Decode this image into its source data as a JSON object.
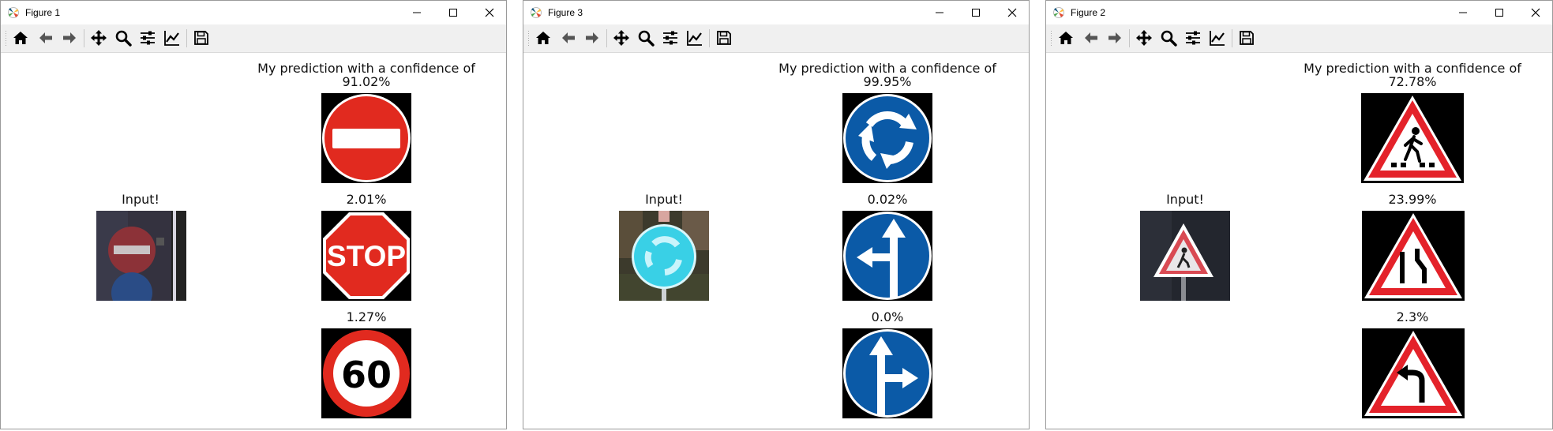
{
  "colors": {
    "prohibitory_red": "#e12a1f",
    "mandatory_blue": "#0b5aa7",
    "warning_red": "#e4222a",
    "toolbar_bg": "#f0f0f0"
  },
  "toolbar_tools": [
    "home-icon",
    "back-arrow-icon",
    "forward-arrow-icon",
    "pan-icon",
    "zoom-icon",
    "subplots-icon",
    "edit-axes-icon",
    "save-icon"
  ],
  "windows": [
    {
      "title": "Figure 1",
      "input_label": "Input!",
      "header_line1": "My prediction with a confidence of",
      "predictions": [
        {
          "confidence": "91.02%",
          "sign": "no-entry-sign"
        },
        {
          "confidence": "2.01%",
          "sign": "stop-sign",
          "sign_text": "STOP"
        },
        {
          "confidence": "1.27%",
          "sign": "speed-limit-60-sign",
          "sign_text": "60"
        }
      ]
    },
    {
      "title": "Figure 3",
      "input_label": "Input!",
      "header_line1": "My prediction with a confidence of",
      "predictions": [
        {
          "confidence": "99.95%",
          "sign": "roundabout-sign"
        },
        {
          "confidence": "0.02%",
          "sign": "straight-or-left-sign"
        },
        {
          "confidence": "0.0%",
          "sign": "straight-or-right-sign"
        }
      ]
    },
    {
      "title": "Figure 2",
      "input_label": "Input!",
      "header_line1": "My prediction with a confidence of",
      "predictions": [
        {
          "confidence": "72.78%",
          "sign": "pedestrian-crossing-sign"
        },
        {
          "confidence": "23.99%",
          "sign": "road-narrows-sign"
        },
        {
          "confidence": "2.3%",
          "sign": "curve-left-sign"
        }
      ]
    }
  ]
}
